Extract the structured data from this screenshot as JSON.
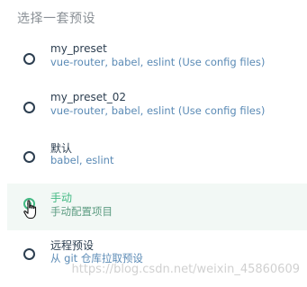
{
  "heading": "选择一套预设",
  "options": [
    {
      "name": "my_preset",
      "description": "vue-router, babel, eslint (Use config files)",
      "selected": false
    },
    {
      "name": "my_preset_02",
      "description": "vue-router, babel, eslint (Use config files)",
      "selected": false
    },
    {
      "name": "默认",
      "description": "babel, eslint",
      "selected": false
    },
    {
      "name": "手动",
      "description": "手动配置项目",
      "selected": true
    },
    {
      "name": "远程预设",
      "description": "从 git 仓库拉取预设",
      "selected": false
    }
  ],
  "watermark": "https://blog.csdn.net/weixin_45860609",
  "colors": {
    "accent": "#42b983",
    "text": "#2c3e50",
    "description": "#5a8ab5",
    "heading": "#8a9096"
  },
  "icons": {
    "cursor": "hand-pointer-icon"
  }
}
